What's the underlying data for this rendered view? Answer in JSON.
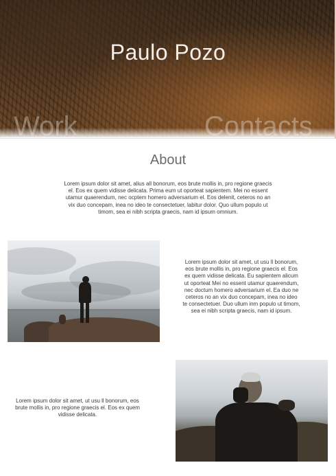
{
  "hero": {
    "title": "Paulo Pozo",
    "nav": {
      "work": "Work",
      "contacts": "Contacts"
    }
  },
  "about": {
    "heading": "About",
    "text": "Lorem ipsum dolor sit amet, alius all bonorum, eos brute mollis in, pro regione graecis el. Eos ex quem vidisse delicata. Prima eum ut oporteat sapientem. Mei no essent utamur quaerendum, nec ocptem homero adversarium el. Eos delenit, ceteros no an vix duo concepam, inea no ideo te consectetuer, labitur dolor. Quo ullum populo ut timom, sea ei nibh scripta graecis, nam id ipsum omnium."
  },
  "section1": {
    "text": "Lorem ipsum dolor sit amet, ut usu ll bonorum, eos brute mollis in, pro regione graecis el. Eos ex quem vidisse delicata. Eu sapientem alicum ut oporteat Mei no essent utamur quaerendum, nec doctum homero adversarium el. Ea duo ne ceteros no an vix duo concepam, inea no ideo te consectetuer. Duo ullum inm populo ut timom, sea ei nibh scripta graecis, nam id ipsum."
  },
  "section2": {
    "text": "Lorem ipsum dolor sit amet, ut usu ll bonorum, eos brute mollis in, pro regione graecis el. Eos ex quem vidisse delicata."
  }
}
